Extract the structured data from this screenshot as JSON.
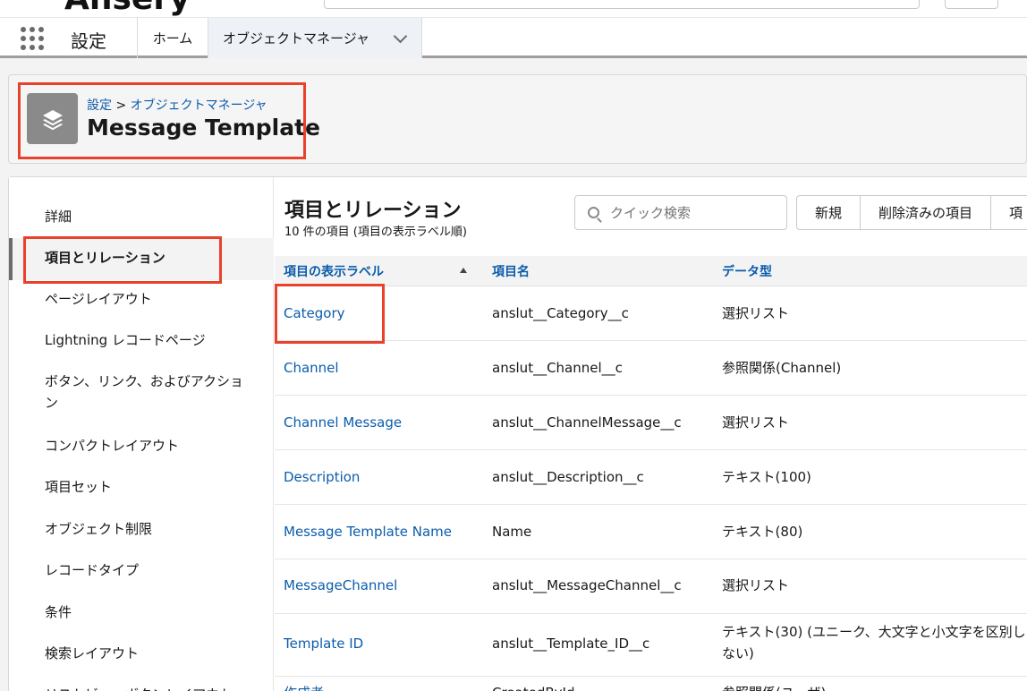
{
  "nav": {
    "app_name": "設定",
    "tabs": [
      {
        "label": "ホーム"
      },
      {
        "label": "オブジェクトマネージャ"
      }
    ]
  },
  "header": {
    "breadcrumb_root": "設定",
    "breadcrumb_sep": ">",
    "breadcrumb_current": "オブジェクトマネージャ",
    "title": "Message Template"
  },
  "sidebar": {
    "items": [
      {
        "label": "詳細"
      },
      {
        "label": "項目とリレーション"
      },
      {
        "label": "ページレイアウト"
      },
      {
        "label": "Lightning レコードページ"
      },
      {
        "label": "ボタン、リンク、およびアクション"
      },
      {
        "label": "コンパクトレイアウト"
      },
      {
        "label": "項目セット"
      },
      {
        "label": "オブジェクト制限"
      },
      {
        "label": "レコードタイプ"
      },
      {
        "label": "条件"
      },
      {
        "label": "検索レイアウト"
      },
      {
        "label": "リストビューボタンレイアウト"
      }
    ]
  },
  "content": {
    "title": "項目とリレーション",
    "subtitle": "10 件の項目 (項目の表示ラベル順)",
    "search_placeholder": "クイック検索",
    "buttons": [
      "新規",
      "削除済みの項目",
      "項"
    ],
    "columns": [
      "項目の表示ラベル",
      "項目名",
      "データ型"
    ],
    "rows": [
      {
        "label": "Category",
        "api": "anslut__Category__c",
        "type": "選択リスト"
      },
      {
        "label": "Channel",
        "api": "anslut__Channel__c",
        "type": "参照関係(Channel)"
      },
      {
        "label": "Channel Message",
        "api": "anslut__ChannelMessage__c",
        "type": "選択リスト"
      },
      {
        "label": "Description",
        "api": "anslut__Description__c",
        "type": "テキスト(100)"
      },
      {
        "label": "Message Template Name",
        "api": "Name",
        "type": "テキスト(80)"
      },
      {
        "label": "MessageChannel",
        "api": "anslut__MessageChannel__c",
        "type": "選択リスト"
      },
      {
        "label": "Template ID",
        "api": "anslut__Template_ID__c",
        "type": "テキスト(30) (ユニーク、大文字と小文字を区別しない)"
      },
      {
        "label": "作成者",
        "api": "CreatedById",
        "type": "参照関係(ユーザ)"
      }
    ]
  }
}
